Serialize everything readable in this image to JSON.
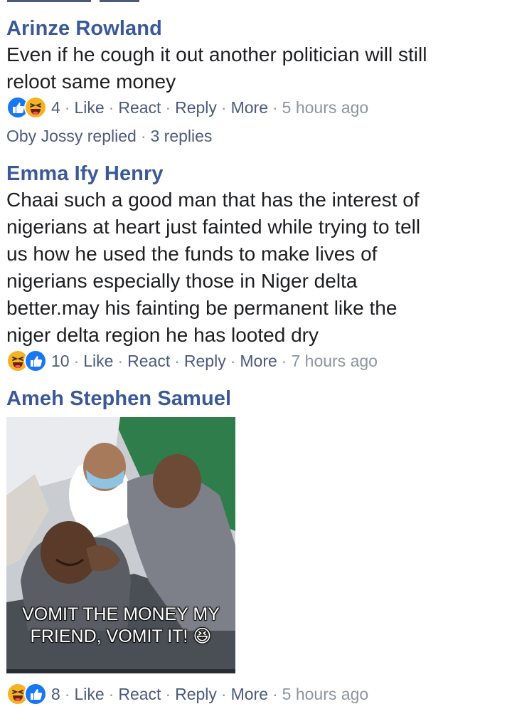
{
  "comments": [
    {
      "author": "Arinze Rowland",
      "text": "Even if he cough it out another politician will still\nreloot same money",
      "reaction_count": "4",
      "actions": {
        "like": "Like",
        "react": "React",
        "reply": "Reply",
        "more": "More"
      },
      "time": "5 hours ago",
      "replies": {
        "replied_by": "Oby Jossy replied",
        "count": "3 replies"
      }
    },
    {
      "author": "Emma Ify Henry",
      "text": "Chaai such a good man that has the interest of\nnigerians at heart just fainted while trying to tell\nus how he used the funds to make lives of\nnigerians especially those in Niger delta\nbetter.may his fainting be permanent like the\nniger delta region he has looted dry",
      "reaction_count": "10",
      "actions": {
        "like": "Like",
        "react": "React",
        "reply": "Reply",
        "more": "More"
      },
      "time": "7 hours ago"
    },
    {
      "author": "Ameh Stephen Samuel",
      "photo_caption": "VOMIT THE MONEY MY\nFRIEND, VOMIT IT! 😆",
      "reaction_count": "8",
      "actions": {
        "like": "Like",
        "react": "React",
        "reply": "Reply",
        "more": "More"
      },
      "time": "5 hours ago"
    }
  ],
  "separator": "·",
  "icons": {
    "like": "like-reaction-icon",
    "haha": "haha-reaction-icon"
  },
  "colors": {
    "author": "#3b5998",
    "action": "#4b5a7c",
    "like": "#1877f2",
    "haha": "#f7b125"
  }
}
